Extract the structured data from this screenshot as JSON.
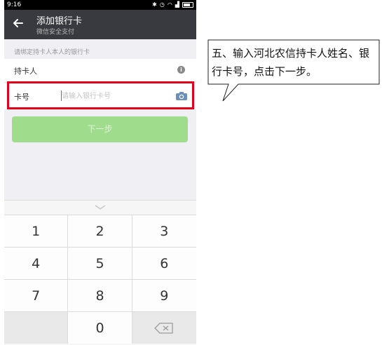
{
  "status": {
    "time": "9:16"
  },
  "appbar": {
    "title": "添加银行卡",
    "subtitle": "微信安全支付"
  },
  "form": {
    "hint": "请绑定持卡人本人的银行卡",
    "holder_label": "持卡人",
    "card_label": "卡号",
    "card_placeholder": "请输入银行卡号",
    "card_value": "",
    "next_label": "下一步"
  },
  "keyboard": {
    "keys": [
      "1",
      "2",
      "3",
      "4",
      "5",
      "6",
      "7",
      "8",
      "9",
      "",
      "0",
      ""
    ]
  },
  "annotation": {
    "text": "五、输入河北农信持卡人姓名、银行卡号，点击下一步。"
  },
  "colors": {
    "appbar": "#393a3f",
    "button": "#9fdc8c",
    "highlight": "#e3001b"
  }
}
